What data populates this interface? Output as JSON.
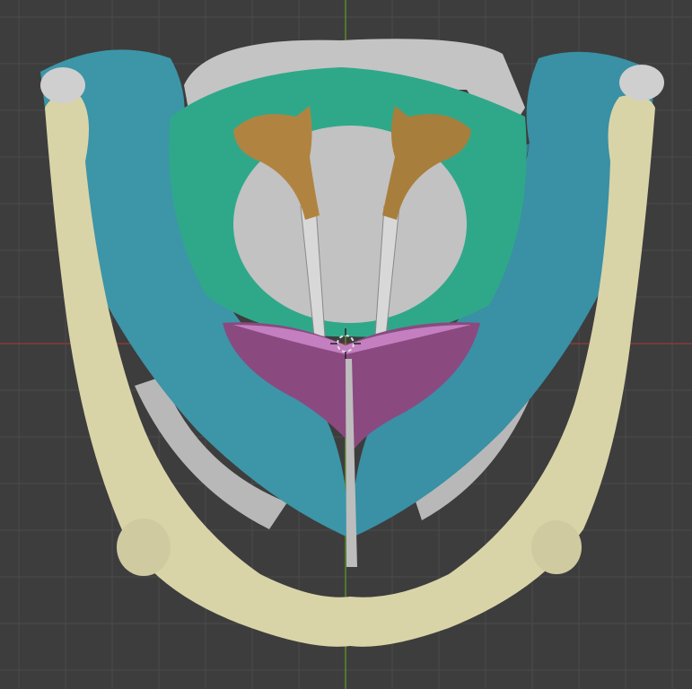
{
  "viewport": {
    "mode": "3d-viewport",
    "background_color": "#3d3d3d",
    "grid_color": "#4a4a4a",
    "x_axis_color": "#8a3a3a",
    "y_axis_color": "#5c8a2a"
  },
  "model": {
    "parts": [
      {
        "name": "hyoid-bone",
        "color": "#d9d4a8"
      },
      {
        "name": "thyroid-cartilage",
        "color": "#3d95a8"
      },
      {
        "name": "cricoid-cartilage",
        "color": "#2fa88a"
      },
      {
        "name": "arytenoid-cartilages",
        "color": "#b08440"
      },
      {
        "name": "epiglottis",
        "color": "#8a4a80"
      },
      {
        "name": "trachea-rings",
        "color": "#c8c8c8"
      }
    ]
  },
  "icons": {
    "cursor": "3d-cursor-icon"
  }
}
